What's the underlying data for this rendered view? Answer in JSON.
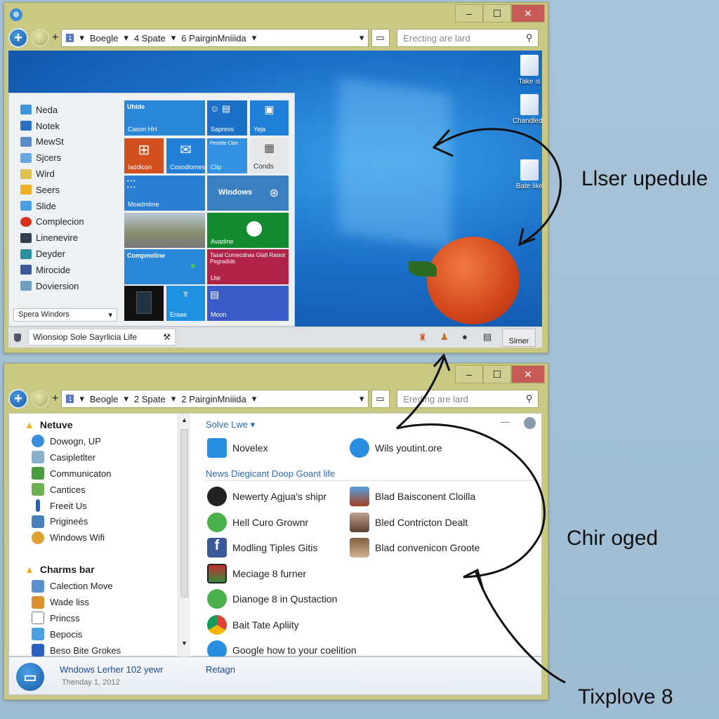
{
  "colors": {
    "frame": "#c9c983",
    "close": "#c95b56",
    "accent": "#1a6fc8",
    "link": "#2a6cb0"
  },
  "top_window": {
    "toolbar": {
      "tab_number": "1",
      "crumbs": [
        "Boegle",
        "4 Spate",
        "6 PairginMniiida"
      ],
      "search_placeholder": "Erecting are lard"
    },
    "desktop_icons": [
      "Take is",
      "Chandlede",
      "Bate like"
    ],
    "start_menu": {
      "items": [
        "Neda",
        "Notek",
        "MewSt",
        "Sjcers",
        "Wird",
        "Seers",
        "Slide",
        "Complecion",
        "Linenevire",
        "Deyder",
        "Mirocide",
        "Doviersion"
      ],
      "dropdown_value": "Spera Windors",
      "tiles": {
        "t1_title": "Uhide",
        "t1_sub": "Cason HH",
        "t2": "Sapress",
        "t3": "Yeja",
        "t4": "Iaddlcon",
        "t5": "Cosodlomes",
        "t6_title": "Pesdde Clan",
        "t6": "Clip",
        "t7": "Conds",
        "t8": "Moadmlme",
        "t9": "Windows",
        "t10": "Avadine",
        "t11_title": "Compmeline",
        "t12_title": "Tasal Comecdnas Glafi Rasiot Pegradids",
        "t12_sub": "Ute",
        "t13": "Eraae",
        "t14": "Moon"
      }
    },
    "taskbar": {
      "search_value": "Wionsiop Sole Sayrlicia Life",
      "tray_label": "Simer"
    }
  },
  "bottom_window": {
    "toolbar": {
      "tab_number": "1",
      "crumbs": [
        "Beogle",
        "2 Spate",
        "2 PairginMniiida"
      ],
      "search_placeholder": "Ereding are lard"
    },
    "left_pane": {
      "group1": {
        "title": "Netuve",
        "items": [
          "Dowogn, UP",
          "Casipletlter",
          "Communicaton",
          "Cantices",
          "Freeit Us",
          "Prigineés",
          "Windows Wifi"
        ]
      },
      "group2": {
        "title": "Charms bar",
        "items": [
          "Calection Move",
          "Wade liss",
          "Princss",
          "Bepocis",
          "Beso Bite Grokes"
        ]
      }
    },
    "right_pane": {
      "section1": {
        "title": "Solve Lwe",
        "items": [
          "Novelex",
          "Wils youtint.ore"
        ]
      },
      "section2": {
        "title": "News Diegicant Doop Goant life",
        "left_items": [
          "Newerty Agjua's shipr",
          "Hell Curo Grownr",
          "Modling Tiples Gitis",
          "Meciage 8 furner",
          "Dianoge 8 in Qustaction",
          "Bait Tate Apliity",
          "Google how to your coelition"
        ],
        "right_items": [
          "Blad Baisconent Cloilla",
          "Bled Contricton Dealt",
          "Blad convenicon Groote"
        ]
      }
    },
    "footer": {
      "title": "Wndows Lerher 102 yewr",
      "date": "Thenday 1, 2012",
      "link": "Retagn"
    }
  },
  "annotations": [
    "Llser upedule",
    "Chir oged",
    "Tixplove 8"
  ]
}
